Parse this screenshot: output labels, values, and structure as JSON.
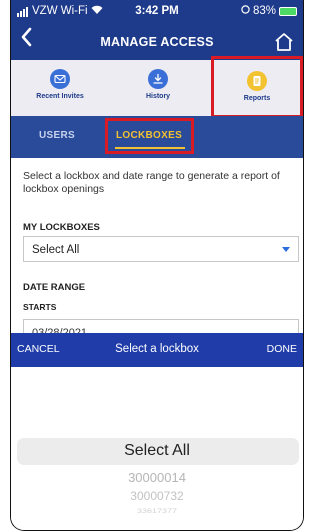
{
  "status": {
    "carrier": "VZW Wi-Fi",
    "time": "3:42 PM",
    "battery": "83%"
  },
  "nav": {
    "title": "MANAGE ACCESS",
    "back_icon": "chevron-left-icon",
    "home_icon": "home-icon"
  },
  "tabs": [
    {
      "label": "Recent Invites",
      "icon": "envelope-icon",
      "color": "#3b6fd8"
    },
    {
      "label": "History",
      "icon": "download-icon",
      "color": "#3b6fd8"
    },
    {
      "label": "Reports",
      "icon": "document-icon",
      "color": "#f2c230"
    }
  ],
  "segments": {
    "users": "USERS",
    "lockboxes": "LOCKBOXES"
  },
  "form": {
    "description": "Select a lockbox and date range to generate a report of lockbox openings",
    "my_lockboxes_label": "MY LOCKBOXES",
    "lockbox_value": "Select All",
    "date_range_label": "DATE RANGE",
    "starts_label": "STARTS",
    "start_value": "03/28/2021"
  },
  "picker": {
    "cancel": "CANCEL",
    "title": "Select a lockbox",
    "done": "DONE",
    "selected": "Select All",
    "options": [
      "30000014",
      "30000732",
      "33617377"
    ]
  },
  "colors": {
    "primary": "#1e3a8a",
    "accent": "#f2c230",
    "highlight": "#d81b25"
  }
}
